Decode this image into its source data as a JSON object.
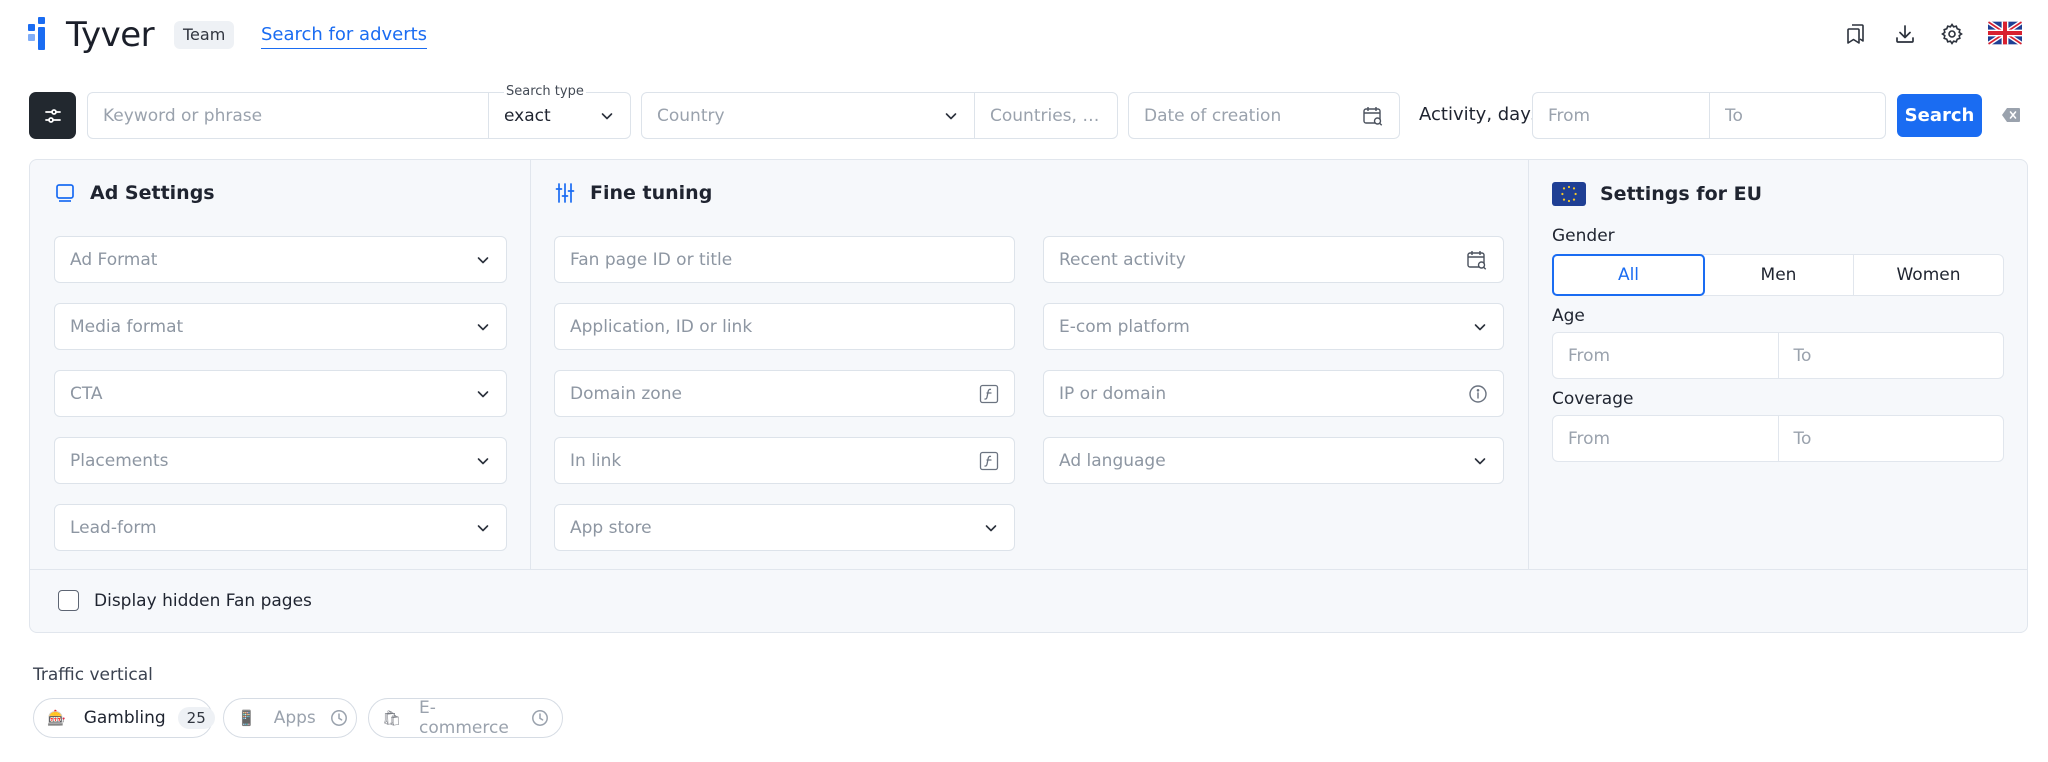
{
  "header": {
    "logo_text": "Tyver",
    "team_badge": "Team",
    "nav_link": "Search for adverts",
    "icons": [
      "bookmarks-icon",
      "download-icon",
      "settings-gear-icon",
      "uk-flag-icon"
    ]
  },
  "search_bar": {
    "keyword_placeholder": "Keyword or phrase",
    "search_type_label": "Search type",
    "search_type_value": "exact",
    "country_placeholder": "Country",
    "countries_placeholder": "Countries, u...",
    "date_placeholder": "Date of creation",
    "activity_label": "Activity, days",
    "activity_from": "From",
    "activity_to": "To",
    "search_button": "Search"
  },
  "ad_settings": {
    "title": "Ad Settings",
    "fields": [
      "Ad Format",
      "Media format",
      "CTA",
      "Placements",
      "Lead-form"
    ]
  },
  "fine_tuning": {
    "title": "Fine tuning",
    "left_fields": [
      "Fan page ID or title",
      "Application, ID or link",
      "Domain zone",
      "In link",
      "App store"
    ],
    "right_fields": [
      "Recent activity",
      "E-com platform",
      "IP or domain",
      "Ad language"
    ]
  },
  "eu_settings": {
    "title": "Settings for EU",
    "gender_label": "Gender",
    "gender_options": [
      "All",
      "Men",
      "Women"
    ],
    "gender_selected": "All",
    "age_label": "Age",
    "age_from": "From",
    "age_to": "To",
    "coverage_label": "Coverage",
    "coverage_from": "From",
    "coverage_to": "To"
  },
  "display_hidden": "Display hidden Fan pages",
  "traffic_vertical": {
    "label": "Traffic vertical",
    "chips": [
      {
        "emoji": "🎰",
        "label": "Gambling",
        "count": "25"
      },
      {
        "emoji": "📱",
        "label": "Apps"
      },
      {
        "emoji": "🛍",
        "label": "E-commerce"
      }
    ]
  },
  "colors": {
    "accent": "#1a6cf2",
    "dark_button": "#22282f",
    "panel_bg": "#f6f8fb",
    "border": "#dde3ea"
  }
}
